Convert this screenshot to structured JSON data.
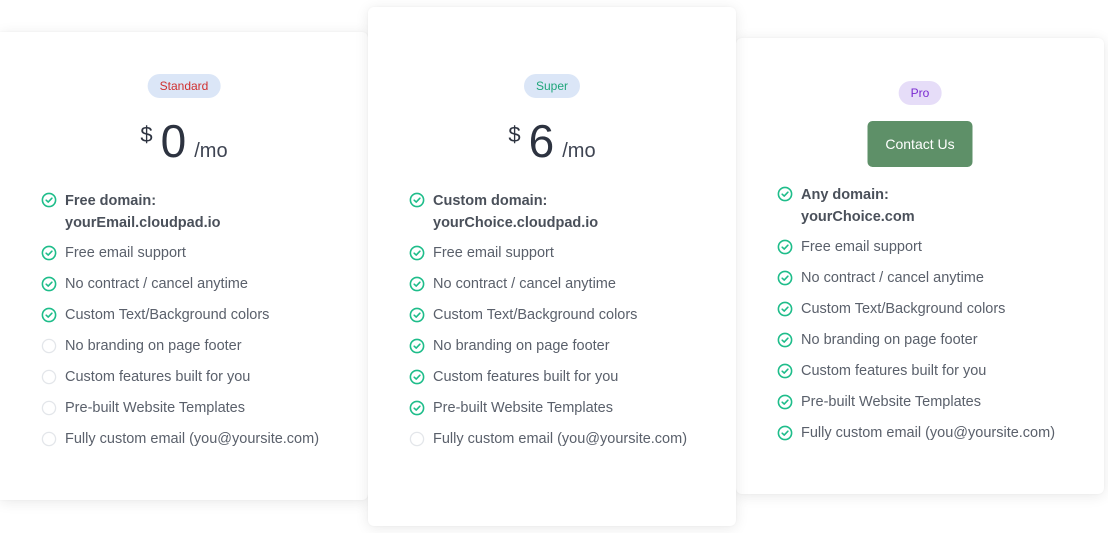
{
  "colors": {
    "check": "#1ebd8a",
    "unchecked": "#e3e6ea",
    "contact_button": "#5e9068"
  },
  "plans": [
    {
      "badge": "Standard",
      "currency": "$",
      "amount": "0",
      "period": "/mo",
      "features": [
        {
          "text": "Free domain:\nyourEmail.cloudpad.io",
          "included": true,
          "bold": true
        },
        {
          "text": "Free email support",
          "included": true
        },
        {
          "text": "No contract / cancel anytime",
          "included": true
        },
        {
          "text": "Custom Text/Background colors",
          "included": true
        },
        {
          "text": "No branding on page footer",
          "included": false
        },
        {
          "text": "Custom features built for you",
          "included": false
        },
        {
          "text": "Pre-built Website Templates",
          "included": false
        },
        {
          "text": "Fully custom email (you@yoursite.com)",
          "included": false
        }
      ]
    },
    {
      "badge": "Super",
      "currency": "$",
      "amount": "6",
      "period": "/mo",
      "features": [
        {
          "text": "Custom domain:\nyourChoice.cloudpad.io",
          "included": true,
          "bold": true
        },
        {
          "text": "Free email support",
          "included": true
        },
        {
          "text": "No contract / cancel anytime",
          "included": true
        },
        {
          "text": "Custom Text/Background colors",
          "included": true
        },
        {
          "text": "No branding on page footer",
          "included": true
        },
        {
          "text": "Custom features built for you",
          "included": true
        },
        {
          "text": "Pre-built Website Templates",
          "included": true
        },
        {
          "text": "Fully custom email (you@yoursite.com)",
          "included": false
        }
      ]
    },
    {
      "badge": "Pro",
      "button_label": "Contact Us",
      "features": [
        {
          "text": "Any domain:\nyourChoice.com",
          "included": true,
          "bold": true
        },
        {
          "text": "Free email support",
          "included": true
        },
        {
          "text": "No contract / cancel anytime",
          "included": true
        },
        {
          "text": "Custom Text/Background colors",
          "included": true
        },
        {
          "text": "No branding on page footer",
          "included": true
        },
        {
          "text": "Custom features built for you",
          "included": true
        },
        {
          "text": "Pre-built Website Templates",
          "included": true
        },
        {
          "text": "Fully custom email (you@yoursite.com)",
          "included": true
        }
      ]
    }
  ]
}
